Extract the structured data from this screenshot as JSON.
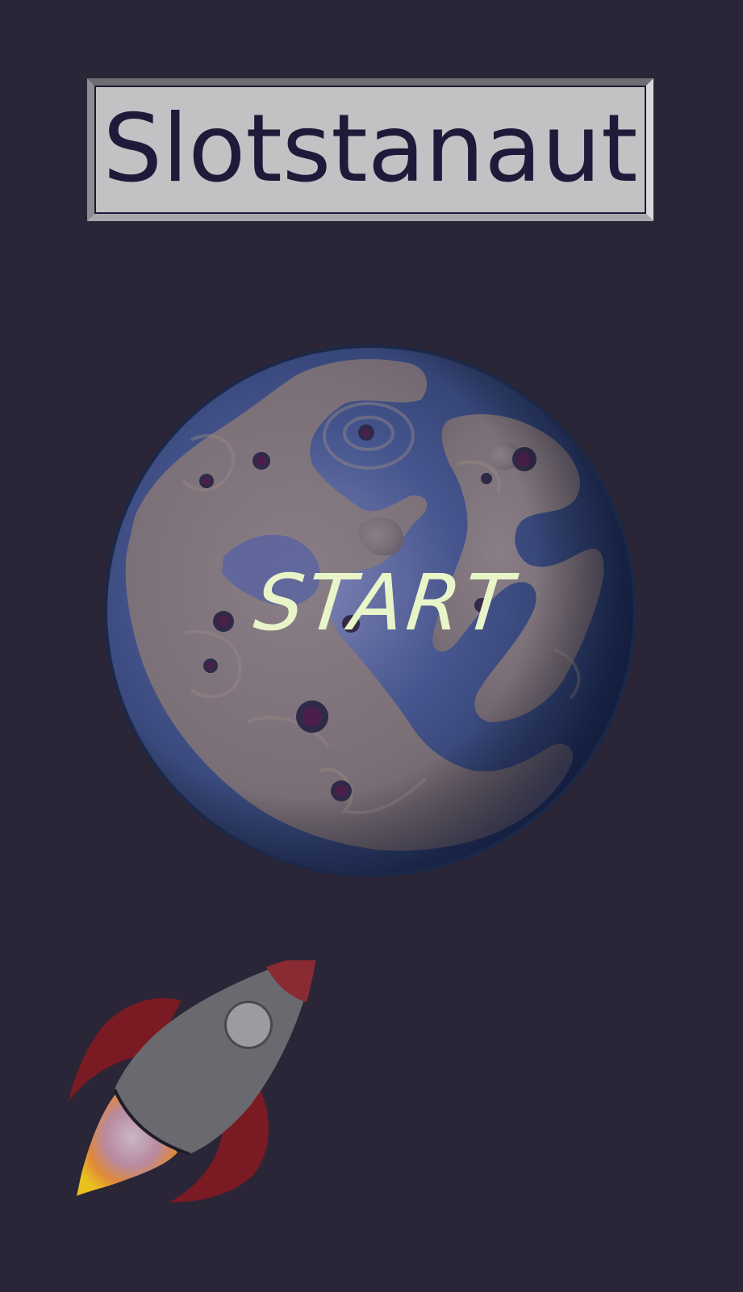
{
  "game": {
    "title": "Slotstanaut",
    "start_label": "START"
  },
  "colors": {
    "background": "#2a2637",
    "title_plate": "#c2c1c4",
    "title_text": "#1e1a3a",
    "planet_ocean": "#3a4a7a",
    "planet_land": "#7e7278",
    "start_text": "#e8f5c8",
    "rocket_body": "#6a696f",
    "rocket_fins": "#7a1a22",
    "rocket_flame": "#e8c020"
  },
  "icons": {
    "planet": "planet-icon",
    "rocket": "rocket-icon"
  }
}
